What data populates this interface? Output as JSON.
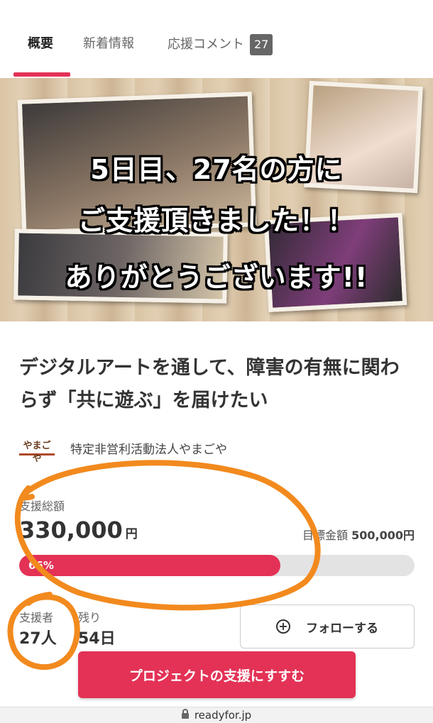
{
  "tabs": [
    {
      "label": "概要",
      "active": true
    },
    {
      "label": "新着情報",
      "active": false
    },
    {
      "label": "応援コメント",
      "badge": "27",
      "active": false
    }
  ],
  "hero": {
    "line1": "5日目、27名の方に",
    "line2": "ご支援頂きました！！",
    "line3": "ありがとうございます!!"
  },
  "project": {
    "title": "デジタルアートを通して、障害の有無に関わらず「共に遊ぶ」を届けたい",
    "org_logo_text": "やまごや",
    "org_name": "特定非営利活動法人やまごや"
  },
  "stats": {
    "total_label": "支援総額",
    "total_amount": "330,000",
    "currency": "円",
    "goal_label": "目標金額",
    "goal_amount": "500,000円",
    "progress_label": "66%",
    "progress_fraction": 0.66,
    "supporters_label": "支援者",
    "supporters_value": "27人",
    "remaining_label": "残り",
    "remaining_value": "54日"
  },
  "actions": {
    "follow_label": "フォローする",
    "support_label": "プロジェクトの支援にすすむ"
  },
  "browser": {
    "url": "readyfor.jp"
  },
  "colors": {
    "accent": "#e33256",
    "annotation": "#f28a1e"
  }
}
